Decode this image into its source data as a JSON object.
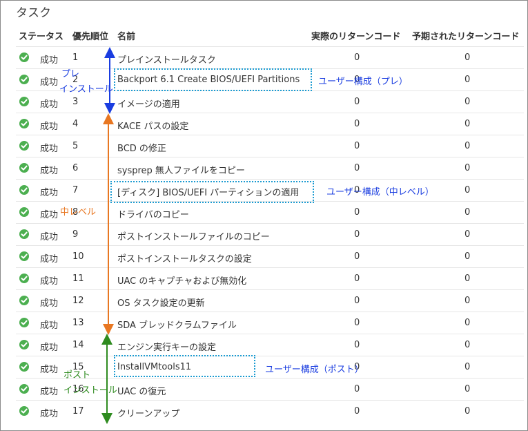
{
  "title": "タスク",
  "columns": {
    "status": "ステータス",
    "priority": "優先順位",
    "name": "名前",
    "actual": "実際のリターンコード",
    "expected": "予期されたリターンコード"
  },
  "rows": [
    {
      "status": "成功",
      "priority": "1",
      "name": "プレインストールタスク",
      "actual": "0",
      "expected": "0"
    },
    {
      "status": "成功",
      "priority": "2",
      "name": "Backport 6.1 Create BIOS/UEFI Partitions",
      "actual": "0",
      "expected": "0"
    },
    {
      "status": "成功",
      "priority": "3",
      "name": "イメージの適用",
      "actual": "0",
      "expected": "0"
    },
    {
      "status": "成功",
      "priority": "4",
      "name": "KACE パスの設定",
      "actual": "0",
      "expected": "0"
    },
    {
      "status": "成功",
      "priority": "5",
      "name": "BCD の修正",
      "actual": "0",
      "expected": "0"
    },
    {
      "status": "成功",
      "priority": "6",
      "name": "sysprep 無人ファイルをコピー",
      "actual": "0",
      "expected": "0"
    },
    {
      "status": "成功",
      "priority": "7",
      "name": "[ディスク] BIOS/UEFI パーティションの適用",
      "actual": "0",
      "expected": "0"
    },
    {
      "status": "成功",
      "priority": "8",
      "name": "ドライバのコピー",
      "actual": "0",
      "expected": "0"
    },
    {
      "status": "成功",
      "priority": "9",
      "name": "ポストインストールファイルのコピー",
      "actual": "0",
      "expected": "0"
    },
    {
      "status": "成功",
      "priority": "10",
      "name": "ポストインストールタスクの設定",
      "actual": "0",
      "expected": "0"
    },
    {
      "status": "成功",
      "priority": "11",
      "name": "UAC のキャプチャおよび無効化",
      "actual": "0",
      "expected": "0"
    },
    {
      "status": "成功",
      "priority": "12",
      "name": "OS タスク設定の更新",
      "actual": "0",
      "expected": "0"
    },
    {
      "status": "成功",
      "priority": "13",
      "name": "SDA ブレッドクラムファイル",
      "actual": "0",
      "expected": "0"
    },
    {
      "status": "成功",
      "priority": "14",
      "name": "エンジン実行キーの設定",
      "actual": "0",
      "expected": "0"
    },
    {
      "status": "成功",
      "priority": "15",
      "name": "InstallVMtools11",
      "actual": "0",
      "expected": "0"
    },
    {
      "status": "成功",
      "priority": "16",
      "name": "UAC の復元",
      "actual": "0",
      "expected": "0"
    },
    {
      "status": "成功",
      "priority": "17",
      "name": "クリーンアップ",
      "actual": "0",
      "expected": "0"
    }
  ],
  "annotations": {
    "pre_label_1": "プレ",
    "pre_label_2": "インストール",
    "mid_label": "中レベル",
    "post_label_1": "ポスト",
    "post_label_2": "インストール",
    "user_pre": "ユーザー構成（プレ）",
    "user_mid": "ユーザー構成（中レベル）",
    "user_post": "ユーザー構成（ポスト）"
  },
  "colors": {
    "success": "#4caf50",
    "pre_arrow": "#1a3de0",
    "mid_arrow": "#e87722",
    "post_arrow": "#2e8b1f",
    "callout_border": "#1b9bd1"
  },
  "icons": {
    "status": "check-circle-icon"
  }
}
